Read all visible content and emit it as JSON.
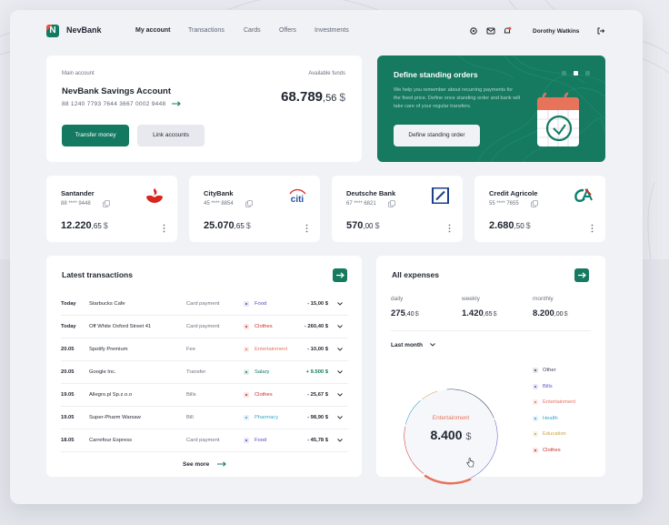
{
  "brand": "NevBank",
  "nav": [
    "My account",
    "Transactions",
    "Cards",
    "Offers",
    "Investments"
  ],
  "user": "Dorothy Watkins",
  "main_account": {
    "label": "Main account",
    "funds_label": "Available funds",
    "title": "NevBank Savings Account",
    "number": "88 1240 7793 7644 3667 0002 9448",
    "amount_int": "68.789",
    "amount_dec": ",56",
    "currency": "$",
    "transfer_label": "Transfer money",
    "link_label": "Link accounts"
  },
  "standing_orders": {
    "title": "Define standing orders",
    "description": "We help you remember about recurring payments for the fixed price. Define once standing order and bank will take care of your regular transfers.",
    "button": "Define standing order"
  },
  "banks": [
    {
      "name": "Santander",
      "number": "88 **** 9448",
      "amount_int": "12.220",
      "amount_dec": ",65",
      "currency": "$",
      "logo": "santander-flame-logo"
    },
    {
      "name": "CityBank",
      "number": "45 **** 8854",
      "amount_int": "25.070",
      "amount_dec": ",65",
      "currency": "$",
      "logo": "citi-logo",
      "logo_text": "citi"
    },
    {
      "name": "Deutsche Bank",
      "number": "67 **** 6821",
      "amount_int": "570",
      "amount_dec": ",00",
      "currency": "$",
      "logo": "deutsche-bank-logo"
    },
    {
      "name": "Credit Agricole",
      "number": "55 **** 7655",
      "amount_int": "2.680",
      "amount_dec": ",50",
      "currency": "$",
      "logo": "credit-agricole-logo"
    }
  ],
  "transactions": {
    "title": "Latest transactions",
    "see_more": "See more",
    "rows": [
      {
        "date": "Today",
        "name": "Starbucks Cafe",
        "type": "Card payment",
        "category": "Food",
        "cat_color": "#4f4ac3",
        "amount": "- 15,00 $"
      },
      {
        "date": "Today",
        "name": "Off White Oxford Street 41",
        "type": "Card payment",
        "category": "Clothes",
        "cat_color": "#c8312a",
        "amount": "- 260,40 $"
      },
      {
        "date": "20.05",
        "name": "Spotify Premium",
        "type": "Fee",
        "category": "Entertainment",
        "cat_color": "#e7735b",
        "amount": "- 10,00 $"
      },
      {
        "date": "20.05",
        "name": "Google Inc.",
        "type": "Transfer",
        "category": "Salary",
        "cat_color": "#137a61",
        "amount": "+ 9.500 $"
      },
      {
        "date": "19.05",
        "name": "Allegro.pl Sp.z.o.o",
        "type": "Bills",
        "category": "Clothes",
        "cat_color": "#c8312a",
        "amount": "- 25,67 $"
      },
      {
        "date": "19.05",
        "name": "Super-Pharm Warsaw",
        "type": "Bill",
        "category": "Pharmacy",
        "cat_color": "#3aa6c9",
        "amount": "- 98,90 $"
      },
      {
        "date": "18.05",
        "name": "Carrefour Express",
        "type": "Card payment",
        "category": "Food",
        "cat_color": "#4f4ac3",
        "amount": "- 45,78 $"
      }
    ]
  },
  "expenses": {
    "title": "All expenses",
    "daily_label": "daily",
    "daily_int": "275",
    "daily_dec": ",40",
    "weekly_label": "weekly",
    "weekly_int": "1.420",
    "weekly_dec": ",65",
    "monthly_label": "monthly",
    "monthly_int": "8.200",
    "monthly_dec": ",00",
    "currency": "$",
    "period": "Last month",
    "center_label": "Entertainment",
    "center_value": "8.400",
    "legend": [
      {
        "label": "Other",
        "color": "#3b3f5c",
        "text_color": "#3b3f5c"
      },
      {
        "label": "Bills",
        "color": "#5b57c9",
        "text_color": "#5b57c9"
      },
      {
        "label": "Entertainment",
        "color": "#e7735b",
        "text_color": "#e7735b"
      },
      {
        "label": "Health",
        "color": "#3aa6c9",
        "text_color": "#3aa6c9"
      },
      {
        "label": "Education",
        "color": "#c9a64a",
        "text_color": "#c9a64a"
      },
      {
        "label": "Clothes",
        "color": "#c8312a",
        "text_color": "#c8312a"
      }
    ]
  },
  "colors": {
    "accent": "#137a61",
    "secondary": "#e7735b",
    "background": "#f1f2f6"
  }
}
